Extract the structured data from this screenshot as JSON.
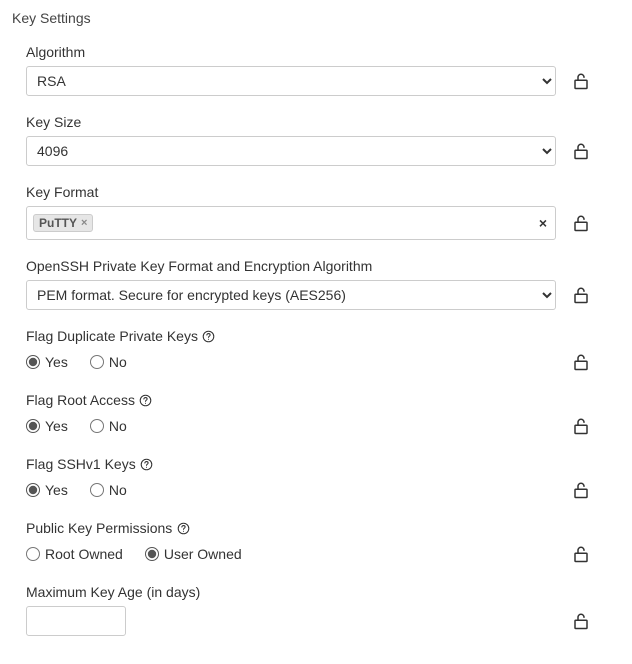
{
  "section": {
    "title": "Key Settings"
  },
  "algorithm": {
    "label": "Algorithm",
    "value": "RSA"
  },
  "key_size": {
    "label": "Key Size",
    "value": "4096"
  },
  "key_format": {
    "label": "Key Format",
    "tags": [
      "PuTTY"
    ]
  },
  "openssh_format": {
    "label": "OpenSSH Private Key Format and Encryption Algorithm",
    "value": "PEM format. Secure for encrypted keys (AES256)"
  },
  "flag_duplicate": {
    "label": "Flag Duplicate Private Keys",
    "options": {
      "yes": "Yes",
      "no": "No"
    },
    "value": "yes"
  },
  "flag_root": {
    "label": "Flag Root Access",
    "options": {
      "yes": "Yes",
      "no": "No"
    },
    "value": "yes"
  },
  "flag_sshv1": {
    "label": "Flag SSHv1 Keys",
    "options": {
      "yes": "Yes",
      "no": "No"
    },
    "value": "yes"
  },
  "public_key_permissions": {
    "label": "Public Key Permissions",
    "options": {
      "root": "Root Owned",
      "user": "User Owned"
    },
    "value": "user"
  },
  "max_key_age": {
    "label": "Maximum Key Age (in days)",
    "value": ""
  }
}
